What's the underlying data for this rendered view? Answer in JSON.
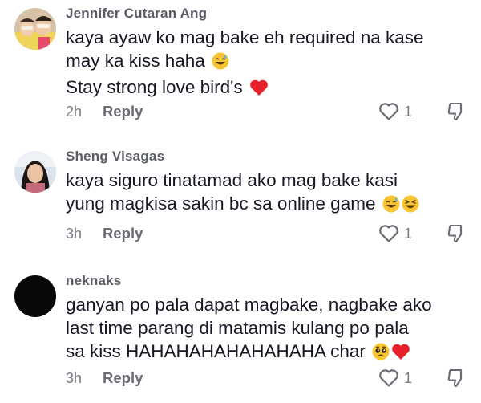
{
  "comments": [
    {
      "username": "Jennifer Cutaran Ang",
      "lines": [
        "kaya ayaw ko mag bake eh required na kase",
        "may ka kiss haha",
        "Stay strong love bird's"
      ],
      "time": "2h",
      "reply_label": "Reply",
      "like_count": "1",
      "emojis": [
        "sweat-smile-emoji",
        "red-heart-emoji"
      ]
    },
    {
      "username": "Sheng Visagas",
      "lines": [
        "kaya siguro tinatamad ako mag bake kasi",
        "yung magkisa sakin bc sa online game"
      ],
      "time": "3h",
      "reply_label": "Reply",
      "like_count": "1",
      "emojis": [
        "sweat-smile-emoji",
        "laughing-squint-emoji"
      ]
    },
    {
      "username": "neknaks",
      "lines": [
        "ganyan po pala dapat magbake, nagbake ako",
        "last time parang di matamis kulang po pala",
        "sa kiss HAHAHAHAHAHAHAHA char"
      ],
      "time": "3h",
      "reply_label": "Reply",
      "like_count": "1",
      "emojis": [
        "pleading-face-emoji",
        "red-heart-emoji"
      ]
    }
  ],
  "colors": {
    "username": "#5a5c66",
    "text": "#161823",
    "meta": "#7b7c83",
    "heart": "#e8202b",
    "emoji_face": "#f7c531"
  }
}
